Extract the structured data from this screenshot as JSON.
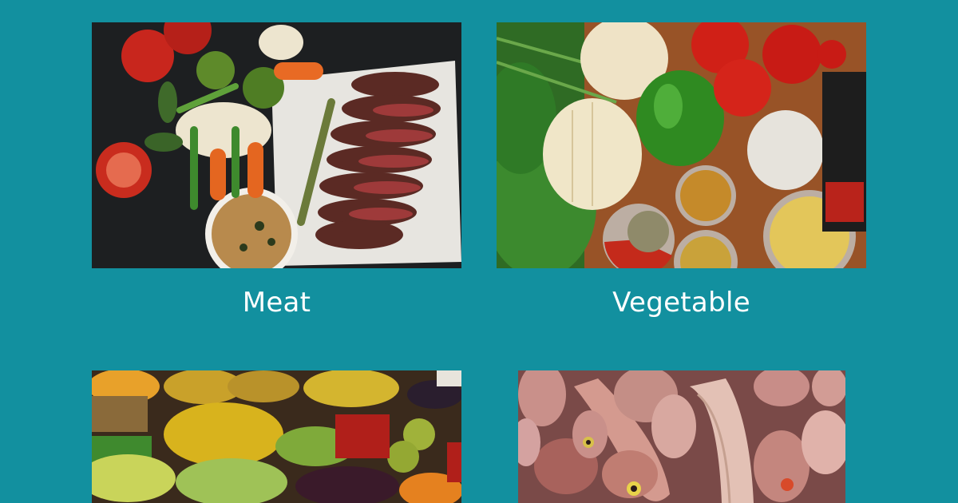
{
  "categories": [
    {
      "label": "Meat",
      "image": "meat-steak-photo"
    },
    {
      "label": "Vegetable",
      "image": "vegetables-photo"
    },
    {
      "label": "",
      "image": "fruit-market-photo"
    },
    {
      "label": "",
      "image": "fish-photo"
    }
  ],
  "colors": {
    "background": "#12909f",
    "label_text": "#ffffff"
  }
}
